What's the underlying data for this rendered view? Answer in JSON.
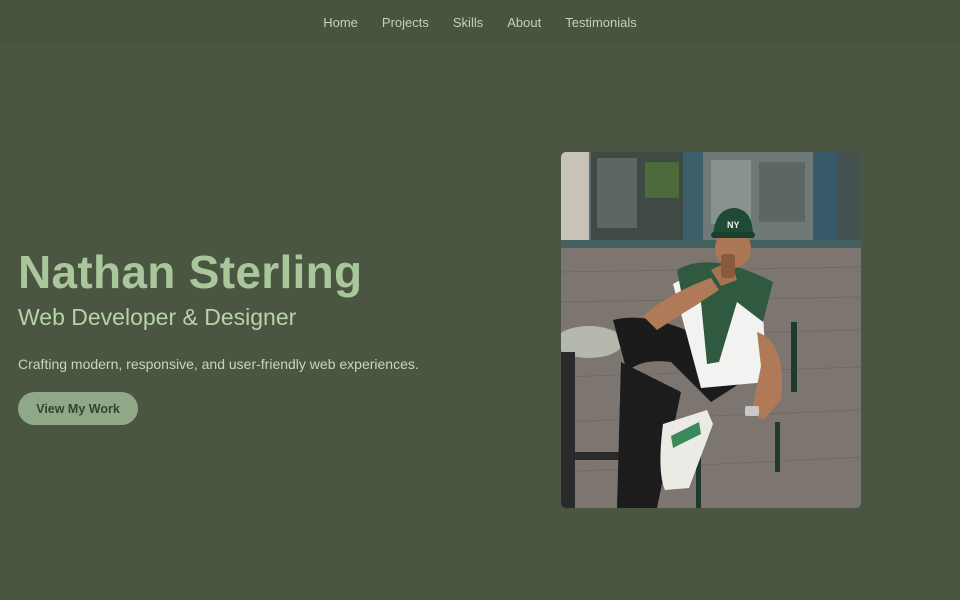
{
  "nav": {
    "items": [
      {
        "label": "Home"
      },
      {
        "label": "Projects"
      },
      {
        "label": "Skills"
      },
      {
        "label": "About"
      },
      {
        "label": "Testimonials"
      }
    ]
  },
  "hero": {
    "name": "Nathan Sterling",
    "role": "Web Developer & Designer",
    "tagline": "Crafting modern, responsive, and user-friendly web experiences.",
    "cta_label": "View My Work"
  },
  "portrait": {
    "alt": "Nathan Sterling",
    "cap_text": "NY"
  },
  "colors": {
    "background": "#4a5641",
    "nav_background": "#485340",
    "accent_name": "#a9c79b",
    "button": "#8fa888"
  }
}
